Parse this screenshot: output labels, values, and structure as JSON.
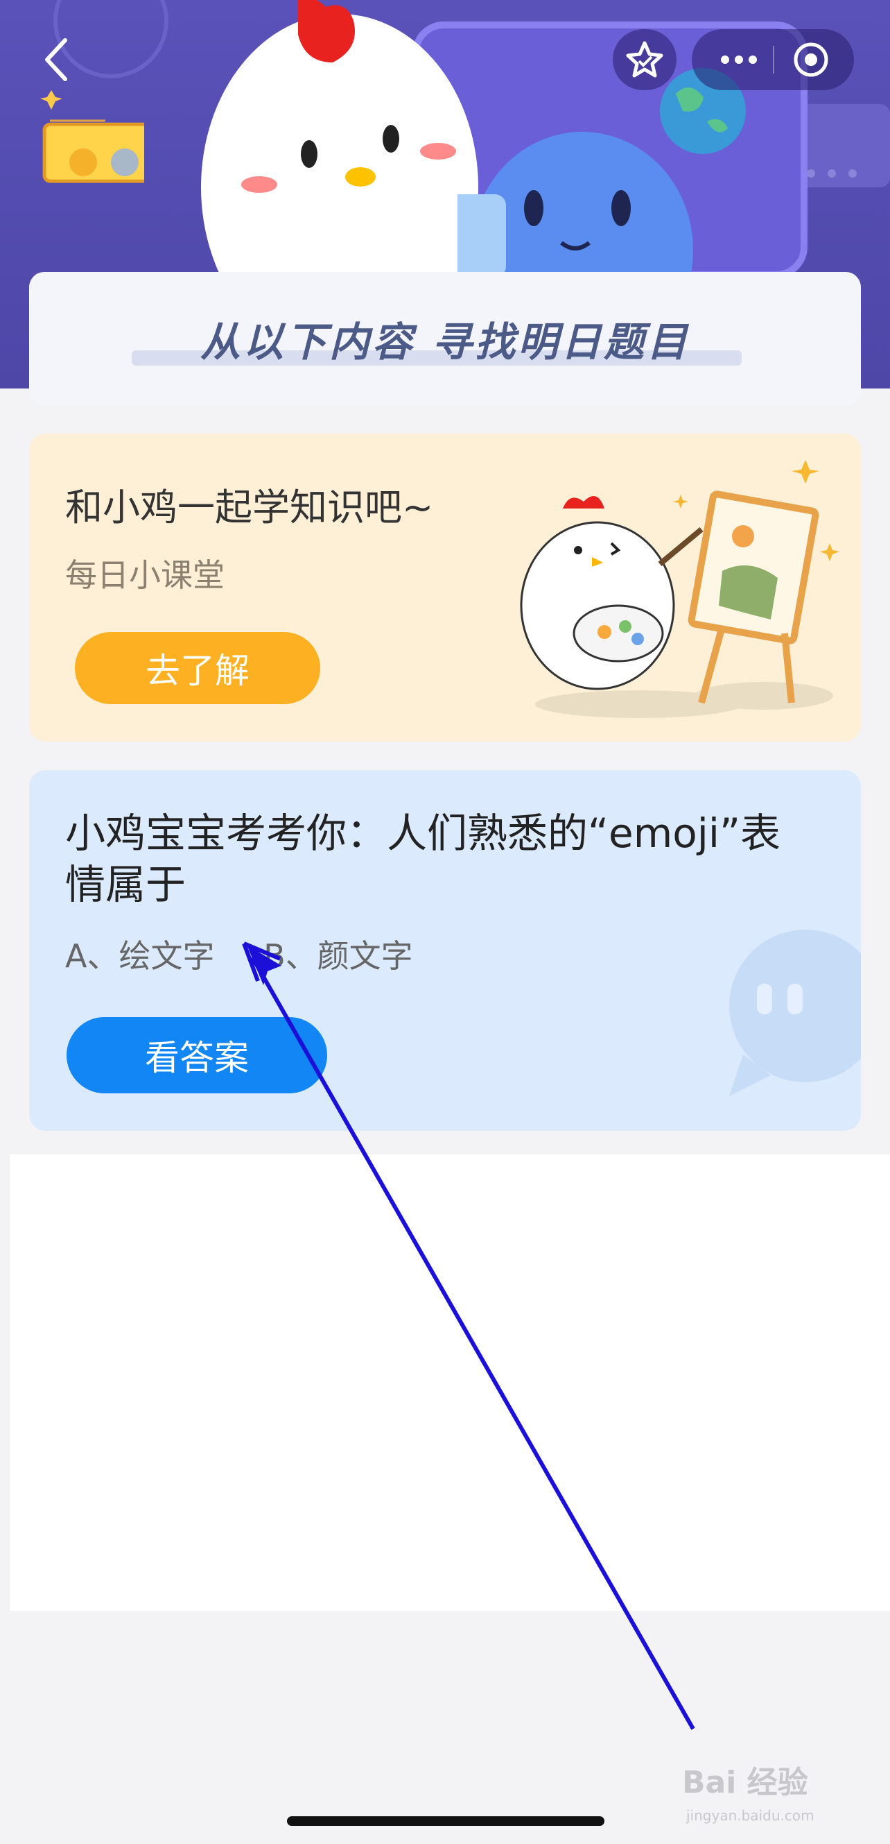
{
  "nav": {
    "back_icon": "chevron-left-icon",
    "favorite_icon": "star-icon",
    "more_icon": "more-dots-icon",
    "close_icon": "target-circle-icon"
  },
  "banner": {
    "title": "从以下内容 寻找明日题目"
  },
  "learn_card": {
    "title": "和小鸡一起学知识吧~",
    "subtitle": "每日小课堂",
    "button_label": "去了解"
  },
  "quiz_card": {
    "question": "小鸡宝宝考考你：人们熟悉的“emoji”表情属于",
    "options": [
      "A、绘文字",
      "B、颜文字"
    ],
    "button_label": "看答案"
  },
  "watermark": {
    "brand": "Bai 经验",
    "url": "jingyan.baidu.com"
  },
  "colors": {
    "hero": "#5a52b8",
    "learn_card_bg": "#fdf0d7",
    "learn_button": "#fdb022",
    "quiz_card_bg": "#dbeafd",
    "answer_button": "#1286f5",
    "annotation_arrow": "#1a10d8"
  }
}
